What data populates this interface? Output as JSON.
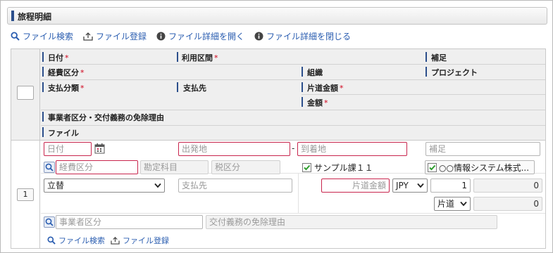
{
  "panel": {
    "title": "旅程明細"
  },
  "toolbar": {
    "file_search": "ファイル検索",
    "file_register": "ファイル登録",
    "open_details": "ファイル詳細を開く",
    "close_details": "ファイル詳細を閉じる"
  },
  "header": {
    "date": "日付",
    "route": "利用区間",
    "supplement": "補足",
    "expense_type": "経費区分",
    "organization": "組織",
    "project": "プロジェクト",
    "payment_class": "支払分類",
    "payee": "支払先",
    "one_way_amount": "片道金額",
    "amount": "金額",
    "exemption_reason": "事業者区分・交付義務の免除理由",
    "file": "ファイル",
    "required_mark": "*"
  },
  "row": {
    "number": "1",
    "date_placeholder": "日付",
    "departure_placeholder": "出発地",
    "route_separator": "-",
    "arrival_placeholder": "到着地",
    "supplement_placeholder": "補足",
    "expense_type_placeholder": "経費区分",
    "account_placeholder": "勘定科目",
    "tax_placeholder": "税区分",
    "org_value": "サンプル課１１",
    "project_value": "○○情報システム株式...",
    "payment_class_value": "立替",
    "payee_placeholder": "支払先",
    "one_way_placeholder": "片道金額",
    "currency_value": "JPY",
    "rate_value": "1",
    "one_way_converted": "0",
    "trip_type_value": "片道",
    "amount_value": "0",
    "business_type_placeholder": "事業者区分",
    "exemption_placeholder": "交付義務の免除理由",
    "file_search": "ファイル検索",
    "file_register": "ファイル登録"
  },
  "colors": {
    "accent": "#2c4f8c",
    "link": "#2a5db0",
    "required": "#d0021b",
    "check": "#2e9e2e"
  }
}
